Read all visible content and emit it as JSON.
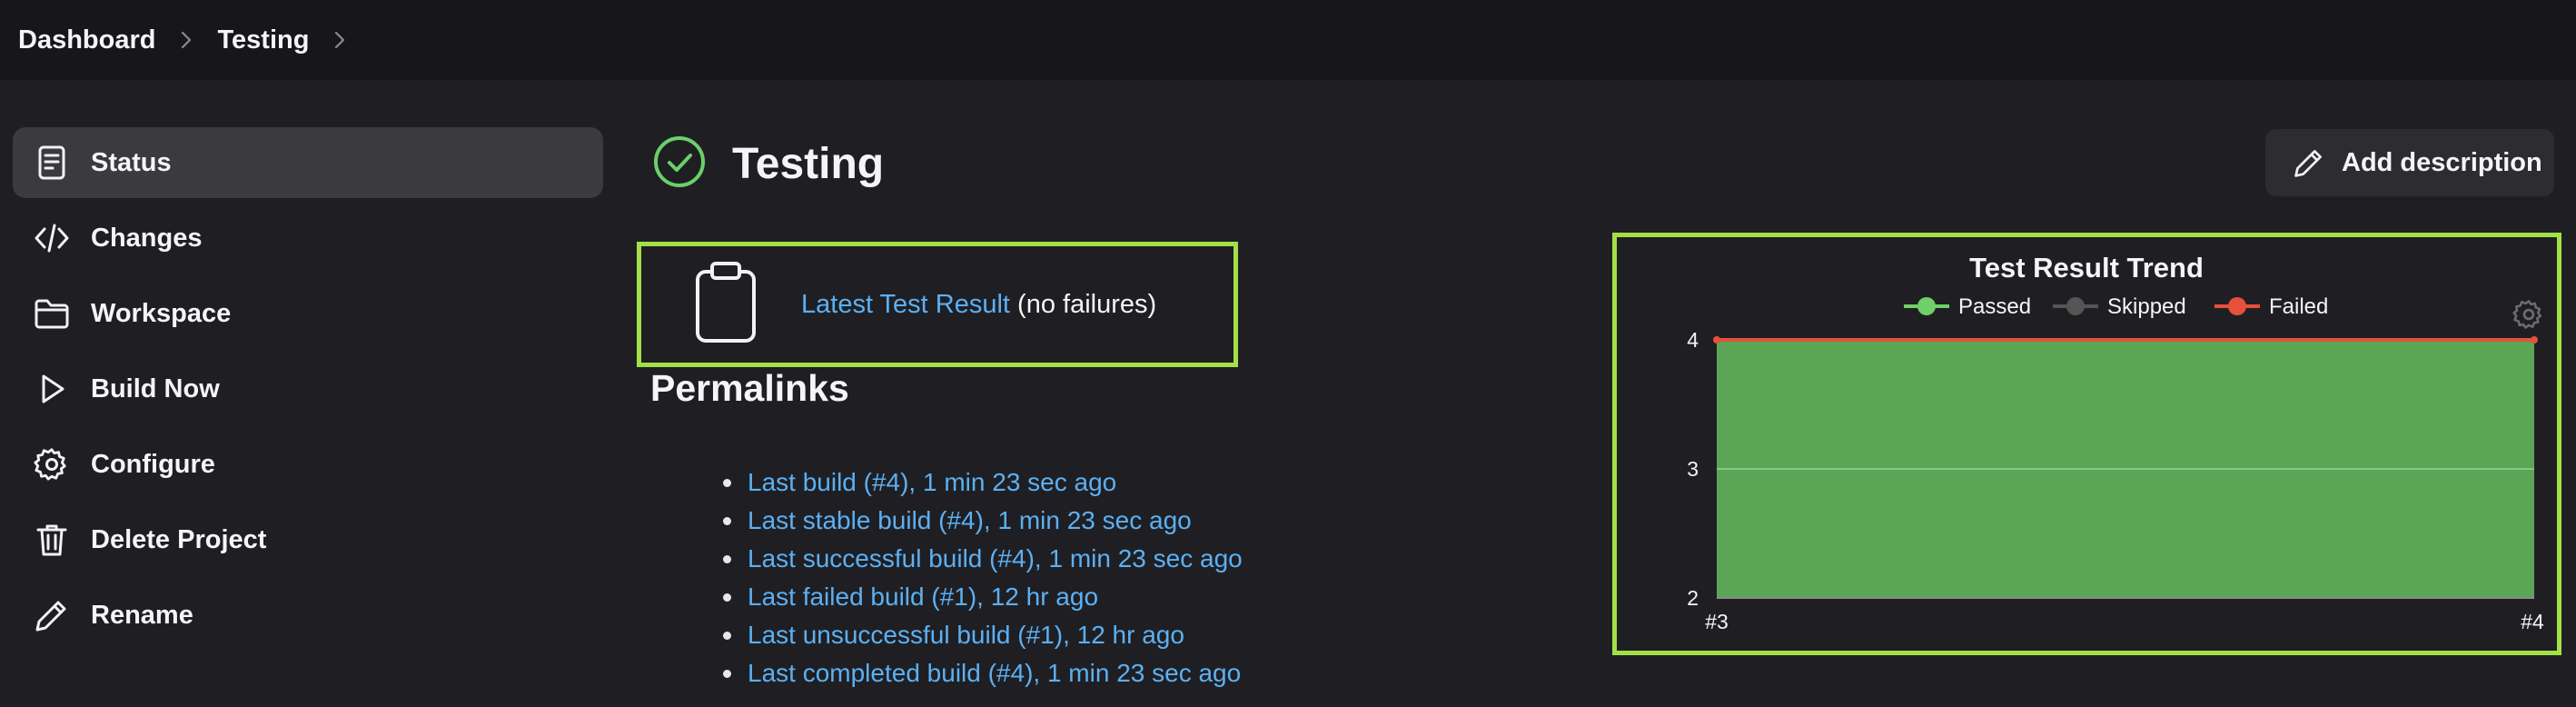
{
  "breadcrumb": {
    "items": [
      "Dashboard",
      "Testing"
    ]
  },
  "sidebar": {
    "items": [
      {
        "label": "Status",
        "icon": "document-icon",
        "active": true
      },
      {
        "label": "Changes",
        "icon": "code-icon"
      },
      {
        "label": "Workspace",
        "icon": "folder-icon"
      },
      {
        "label": "Build Now",
        "icon": "play-icon"
      },
      {
        "label": "Configure",
        "icon": "gear-icon"
      },
      {
        "label": "Delete Project",
        "icon": "trash-icon"
      },
      {
        "label": "Rename",
        "icon": "pencil-icon"
      }
    ]
  },
  "main": {
    "title": "Testing",
    "status_icon": "check-circle-icon",
    "add_description_label": "Add description",
    "latest_result": {
      "link_text": "Latest Test Result",
      "suffix": "(no failures)"
    },
    "permalinks": {
      "title": "Permalinks",
      "items": [
        "Last build (#4), 1 min 23 sec ago",
        "Last stable build (#4), 1 min 23 sec ago",
        "Last successful build (#4), 1 min 23 sec ago",
        "Last failed build (#1), 12 hr ago",
        "Last unsuccessful build (#1), 12 hr ago",
        "Last completed build (#4), 1 min 23 sec ago"
      ]
    }
  },
  "colors": {
    "accent_border": "#a3e048",
    "link": "#5cb0f3",
    "passed": "#5ba557",
    "passed_legend": "#6fd06a",
    "skipped": "#555555",
    "failed": "#e6503c",
    "success_icon": "#6ad06a"
  },
  "chart_data": {
    "type": "area",
    "title": "Test Result Trend",
    "categories": [
      "#3",
      "#4"
    ],
    "series": [
      {
        "name": "Passed",
        "values": [
          4,
          4
        ]
      },
      {
        "name": "Skipped",
        "values": [
          0,
          0
        ]
      },
      {
        "name": "Failed",
        "values": [
          0,
          0
        ]
      }
    ],
    "ylim": [
      2,
      4
    ],
    "yticks": [
      "2",
      "3",
      "4"
    ],
    "legend": "top-center",
    "grid": true
  }
}
